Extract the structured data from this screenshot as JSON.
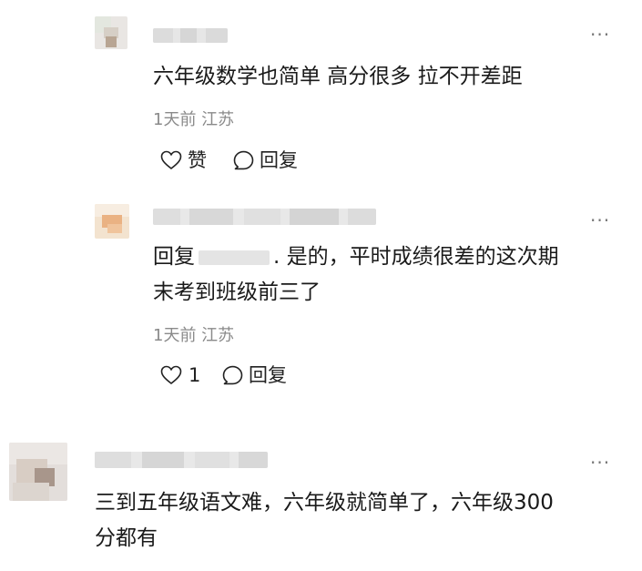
{
  "comments": [
    {
      "text": "六年级数学也简单 高分很多 拉不开差距",
      "meta": "1天前 江苏",
      "like_label": "赞",
      "reply_label": "回复",
      "more": "···"
    },
    {
      "reply_prefix": "回复",
      "text_after_name": ". 是的，平时成绩很差的这次期",
      "text_line2": "末考到班级前三了",
      "meta": "1天前 江苏",
      "like_count": "1",
      "reply_label": "回复",
      "more": "···"
    },
    {
      "text_line1": "三到五年级语文难，六年级就简单了，六年级300",
      "text_line2": "分都有",
      "more": "···"
    }
  ],
  "colors": {
    "text": "#1a1a1a",
    "meta": "#8a8a8a",
    "icon": "#222222"
  }
}
